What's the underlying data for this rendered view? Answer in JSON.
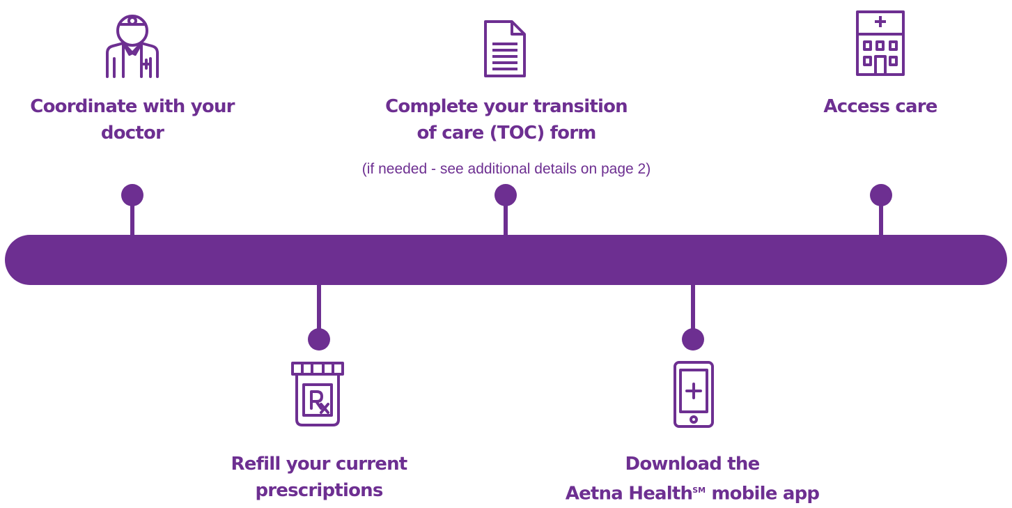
{
  "colors": {
    "accent": "#6d2f91",
    "background": "#ffffff"
  },
  "steps": [
    {
      "icon": "doctor-icon",
      "line1": "Coordinate with your",
      "line2": "doctor"
    },
    {
      "icon": "document-icon",
      "line1": "Complete your transition",
      "line2": "of care (TOC) form",
      "note": "(if needed - see additional details on page 2)"
    },
    {
      "icon": "hospital-icon",
      "line1": "Access care"
    },
    {
      "icon": "prescription-bottle-icon",
      "line1": "Refill your current",
      "line2": "prescriptions"
    },
    {
      "icon": "mobile-phone-icon",
      "line1": "Download the",
      "line2_pre": "Aetna Health",
      "line2_mark": "SM",
      "line2_post": " mobile app"
    }
  ]
}
